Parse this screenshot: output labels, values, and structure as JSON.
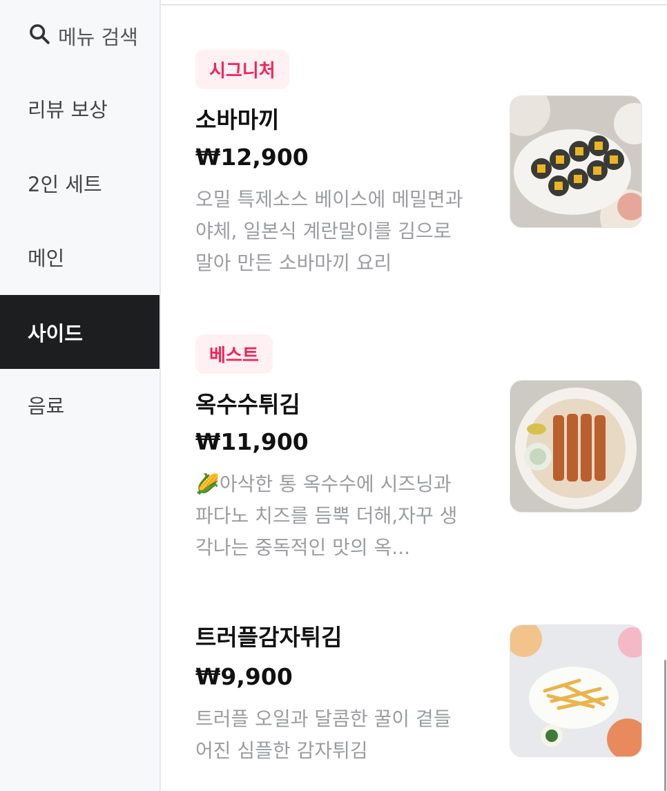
{
  "sidebar": {
    "search_label": "메뉴 검색",
    "categories": [
      {
        "label": "리뷰 보상"
      },
      {
        "label": "2인 세트"
      },
      {
        "label": "메인"
      },
      {
        "label": "사이드"
      },
      {
        "label": "음료"
      }
    ],
    "active_category": "사이드"
  },
  "items": [
    {
      "badge": "시그니처",
      "name": "소바마끼",
      "price": "₩12,900",
      "description": "오밀 특제소스 베이스에 메밀면과 야체, 일본식 계란말이를 김으로 말아 만든 소바마끼 요리"
    },
    {
      "badge": "베스트",
      "name": "옥수수튀김",
      "price": "₩11,900",
      "description": "🌽아삭한 통 옥수수에 시즈닝과 파다노 치즈를 듬뿍 더해,자꾸 생각나는 중독적인 맛의 옥..."
    },
    {
      "name": "트러플감자튀김",
      "price": "₩9,900",
      "description": "트러플 오일과 달콤한 꿀이 곁들어진 심플한 감자튀김"
    }
  ],
  "colors": {
    "badge_text": "#f0245a",
    "badge_bg": "#fff0f3",
    "active_bg": "#1d1e20",
    "sidebar_bg": "#f7f8fa"
  }
}
